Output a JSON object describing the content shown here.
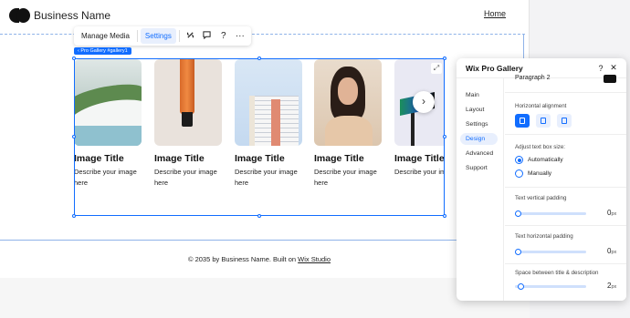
{
  "site": {
    "brand": "Business Name",
    "home_link": "Home"
  },
  "toolbar": {
    "manage_media": "Manage Media",
    "settings": "Settings",
    "link_icon": "link-icon",
    "comment_icon": "comment-icon",
    "help_icon": "?",
    "more_icon": "···"
  },
  "gallery": {
    "tag": "‹ Pro Gallery #gallery1",
    "items": [
      {
        "title": "Image Title",
        "desc": "Describe your image here"
      },
      {
        "title": "Image Title",
        "desc": "Describe your image here"
      },
      {
        "title": "Image Title",
        "desc": "Describe your image here"
      },
      {
        "title": "Image Title",
        "desc": "Describe your image here"
      },
      {
        "title": "Image Title",
        "desc": "Describe your image"
      }
    ],
    "next_icon": "›",
    "expand_icon": "⤢"
  },
  "footer": {
    "text": "© 2035 by Business Name. Built on ",
    "link": "Wix Studio"
  },
  "panel": {
    "title": "Wix Pro Gallery",
    "help": "?",
    "close": "✕",
    "nav": [
      "Main",
      "Layout",
      "Settings",
      "Design",
      "Advanced",
      "Support"
    ],
    "active_nav": "Design",
    "cut_label": "Paragraph 2",
    "horizontal_alignment": "Horizontal alignment",
    "adjust_text_box": "Adjust text box size:",
    "radio_auto": "Automatically",
    "radio_manual": "Manually",
    "text_vertical_padding": "Text vertical padding",
    "text_horizontal_padding": "Text horizontal padding",
    "space_between": "Space between title & description",
    "vertical_padding_value": "0",
    "horizontal_padding_value": "0",
    "space_value": "2",
    "unit": "px"
  },
  "colors": {
    "accent": "#116dff",
    "selection": "#e8effd"
  }
}
